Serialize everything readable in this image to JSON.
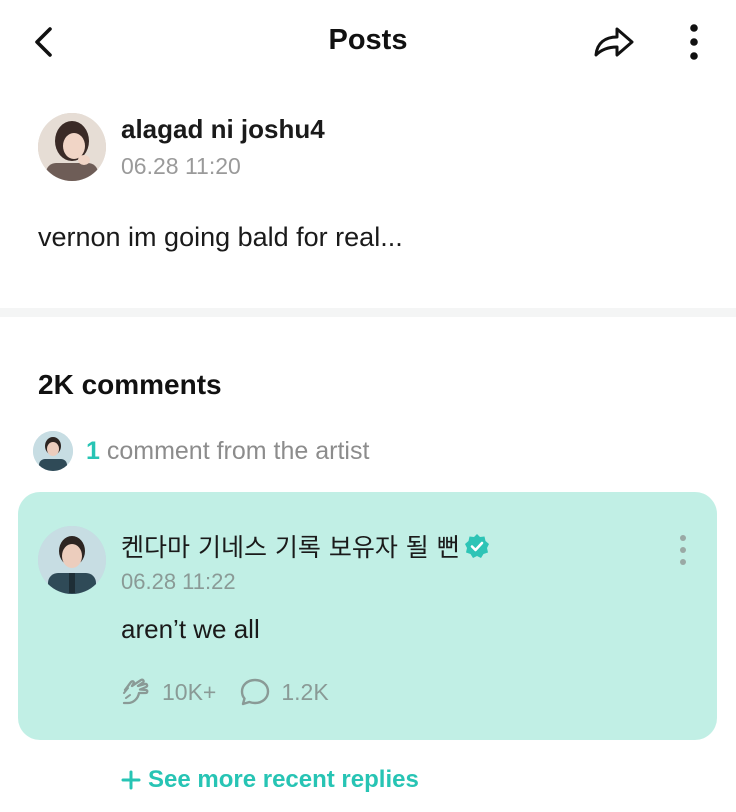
{
  "header": {
    "title": "Posts"
  },
  "post": {
    "author_name": "alagad ni joshu4",
    "timestamp": "06.28 11:20",
    "body": "vernon im going bald for real..."
  },
  "comments": {
    "count_label": "2K comments",
    "artist_summary": {
      "count": "1",
      "text": " comment from the artist"
    },
    "artist_comment": {
      "author_name": "켄다마 기네스 기록 보유자 될 뻔",
      "timestamp": "06.28 11:22",
      "body": "aren’t we all",
      "likes": "10K+",
      "replies": "1.2K"
    },
    "see_more_label": "See more recent replies"
  },
  "colors": {
    "accent": "#27c4b4",
    "card_background": "#c1efe5",
    "verified": "#2ec4b6"
  },
  "icons": {
    "back": "chevron-left-icon",
    "share": "share-arrow-icon",
    "more": "vertical-dots-icon",
    "verified": "verified-badge-icon",
    "like": "pet-hand-icon",
    "reply": "speech-bubble-icon",
    "plus": "plus-icon"
  }
}
